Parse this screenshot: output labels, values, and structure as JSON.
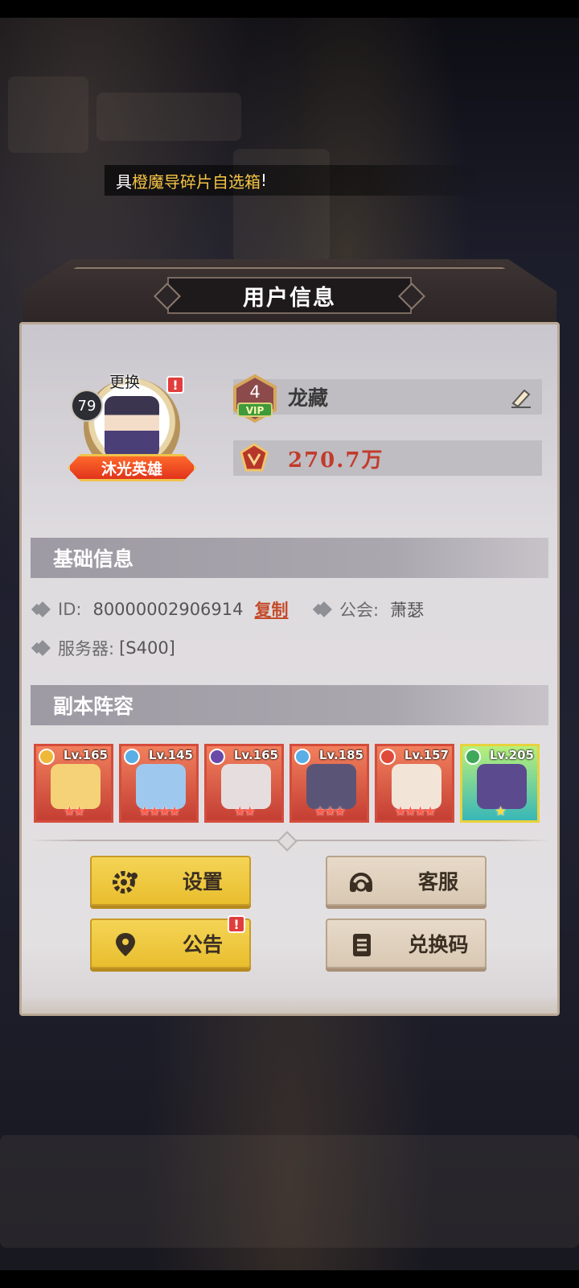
{
  "marquee": {
    "prefix": "具",
    "highlight": "橙魔导碎片自选箱",
    "suffix": "!"
  },
  "panel": {
    "title": "用户信息"
  },
  "profile": {
    "level": "79",
    "change_label": "更换",
    "title_badge": "沐光英雄",
    "vip_level": "4",
    "vip_label": "VIP",
    "name": "龙藏",
    "power": "270.7万"
  },
  "basic_info": {
    "header": "基础信息",
    "id_label": "ID:",
    "id_value": "80000002906914",
    "copy_label": "复制",
    "guild_label": "公会:",
    "guild_value": "萧瑟",
    "server_label": "服务器:",
    "server_value": "[S400]"
  },
  "lineup": {
    "header": "副本阵容",
    "heroes": [
      {
        "level": "Lv.165",
        "stars": "★★",
        "element_color": "#f0b838",
        "art_color": "#f5d277"
      },
      {
        "level": "Lv.145",
        "stars": "★★★★",
        "element_color": "#5aaee6",
        "art_color": "#9fc8ef"
      },
      {
        "level": "Lv.165",
        "stars": "★★",
        "element_color": "#6a4aa8",
        "art_color": "#e6dede"
      },
      {
        "level": "Lv.185",
        "stars": "★★★",
        "element_color": "#5aaee6",
        "art_color": "#5a5577"
      },
      {
        "level": "Lv.157",
        "stars": "★★★★",
        "element_color": "#e04a3a",
        "art_color": "#f3e4d8"
      },
      {
        "level": "Lv.205",
        "stars": "★",
        "element_color": "#3fa85a",
        "art_color": "#5b4a8e"
      }
    ]
  },
  "buttons": {
    "settings": "设置",
    "service": "客服",
    "notice": "公告",
    "redeem": "兑换码"
  },
  "alert_mark": "!"
}
